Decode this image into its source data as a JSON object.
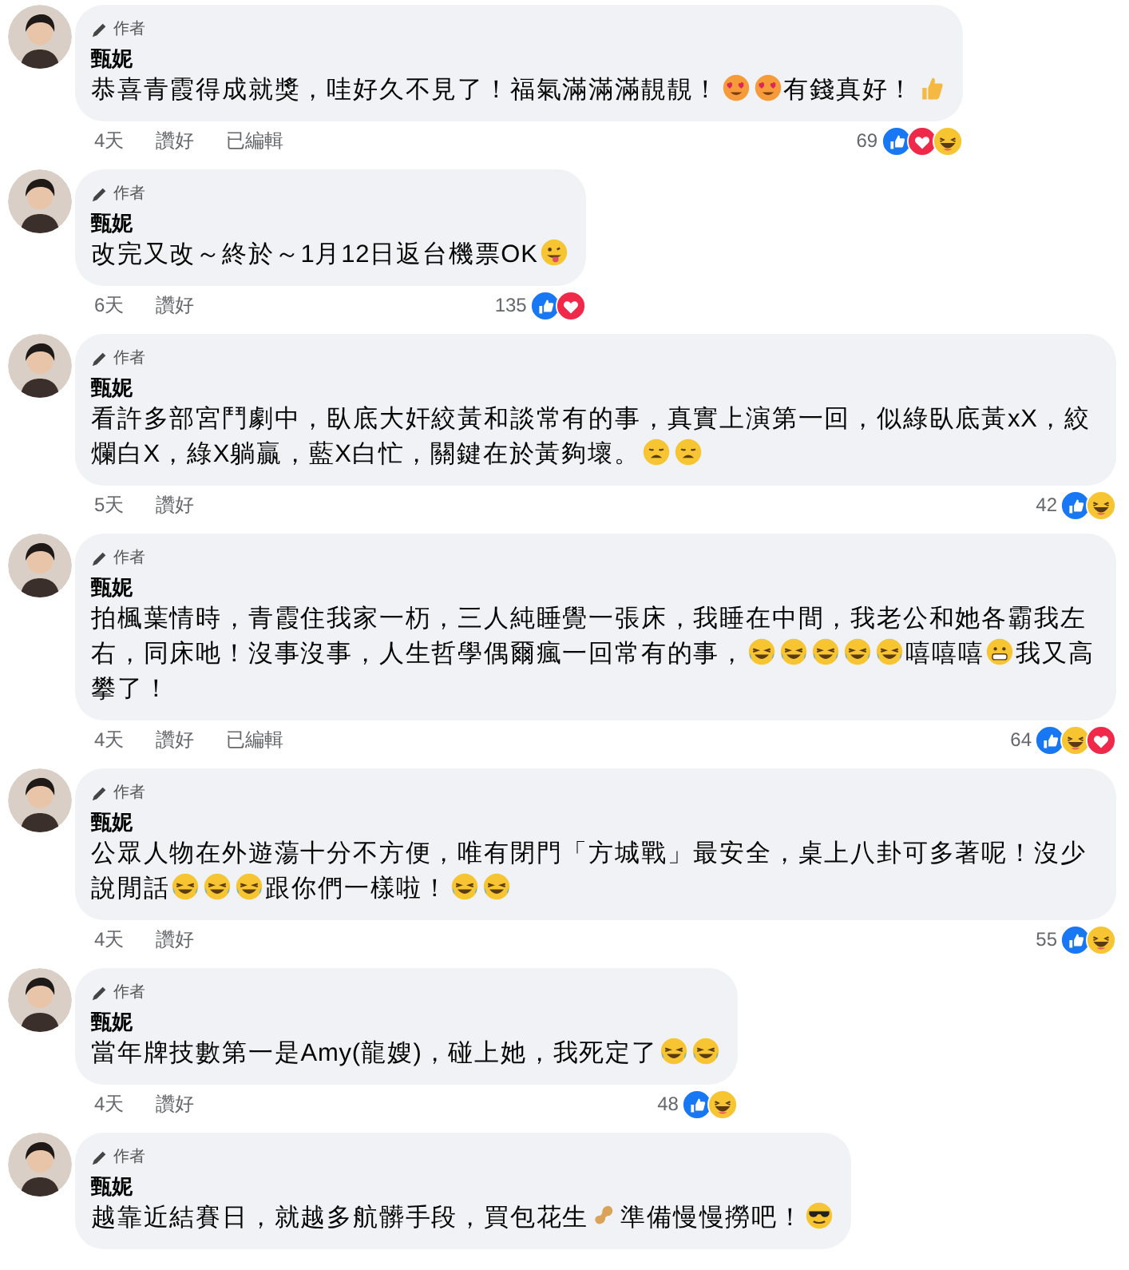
{
  "comments": [
    {
      "badge": "作者",
      "author": "甄妮",
      "body": [
        {
          "kind": "text",
          "text": "恭喜青霞得成就獎，哇好久不見了！福氣滿滿滿靚靚！"
        },
        {
          "kind": "hearteyes"
        },
        {
          "kind": "hearteyes"
        },
        {
          "kind": "text",
          "text": "有錢真好！"
        },
        {
          "kind": "thumbsup"
        }
      ],
      "time": "4天",
      "like_action": "讚好",
      "edited": "已編輯",
      "count": "69",
      "reactions": [
        {
          "kind": "like"
        },
        {
          "kind": "love"
        },
        {
          "kind": "haha"
        }
      ]
    },
    {
      "badge": "作者",
      "author": "甄妮",
      "body": [
        {
          "kind": "text",
          "text": "改完又改～終於～1月12日返台機票OK"
        },
        {
          "kind": "tongue"
        }
      ],
      "time": "6天",
      "like_action": "讚好",
      "count": "135",
      "reactions": [
        {
          "kind": "like"
        },
        {
          "kind": "love"
        }
      ]
    },
    {
      "badge": "作者",
      "author": "甄妮",
      "body": [
        {
          "kind": "text",
          "text": "看許多部宮鬥劇中，臥底大奸絞黃和談常有的事，真實上演第一回，似綠臥底黃xX，絞爛白X，綠X躺贏，藍X白忙，關鍵在於黃夠壞。"
        },
        {
          "kind": "weary"
        },
        {
          "kind": "weary"
        }
      ],
      "time": "5天",
      "like_action": "讚好",
      "count": "42",
      "reactions": [
        {
          "kind": "like"
        },
        {
          "kind": "haha"
        }
      ]
    },
    {
      "badge": "作者",
      "author": "甄妮",
      "body": [
        {
          "kind": "text",
          "text": "拍楓葉情時，青霞住我家一杤，三人純睡覺一張床，我睡在中間，我老公和她各霸我左右，同床吔！沒事沒事，人生哲學偶爾瘋一回常有的事，"
        },
        {
          "kind": "laugh"
        },
        {
          "kind": "laugh"
        },
        {
          "kind": "laugh"
        },
        {
          "kind": "laugh"
        },
        {
          "kind": "laugh"
        },
        {
          "kind": "text",
          "text": "嘻嘻嘻"
        },
        {
          "kind": "grimace"
        },
        {
          "kind": "text",
          "text": "我又高攀了！"
        }
      ],
      "time": "4天",
      "like_action": "讚好",
      "edited": "已編輯",
      "count": "64",
      "reactions": [
        {
          "kind": "like"
        },
        {
          "kind": "haha"
        },
        {
          "kind": "love"
        }
      ]
    },
    {
      "badge": "作者",
      "author": "甄妮",
      "body": [
        {
          "kind": "text",
          "text": "公眾人物在外遊蕩十分不方便，唯有閉門「方城戰」最安全，桌上八卦可多著呢！沒少說閒話"
        },
        {
          "kind": "laugh"
        },
        {
          "kind": "laugh"
        },
        {
          "kind": "laugh"
        },
        {
          "kind": "text",
          "text": "跟你們一樣啦！"
        },
        {
          "kind": "laugh"
        },
        {
          "kind": "laugh"
        }
      ],
      "time": "4天",
      "like_action": "讚好",
      "count": "55",
      "reactions": [
        {
          "kind": "like"
        },
        {
          "kind": "haha"
        }
      ]
    },
    {
      "badge": "作者",
      "author": "甄妮",
      "body": [
        {
          "kind": "text",
          "text": "當年牌技數第一是Amy(龍嫂)，碰上她，我死定了"
        },
        {
          "kind": "laugh"
        },
        {
          "kind": "laugh"
        }
      ],
      "time": "4天",
      "like_action": "讚好",
      "count": "48",
      "reactions": [
        {
          "kind": "like"
        },
        {
          "kind": "haha"
        }
      ]
    },
    {
      "badge": "作者",
      "author": "甄妮",
      "body": [
        {
          "kind": "text",
          "text": "越靠近結賽日，就越多航髒手段，買包花生"
        },
        {
          "kind": "peanut"
        },
        {
          "kind": "text",
          "text": "準備慢慢撈吧！"
        },
        {
          "kind": "sunglasses"
        }
      ]
    }
  ]
}
